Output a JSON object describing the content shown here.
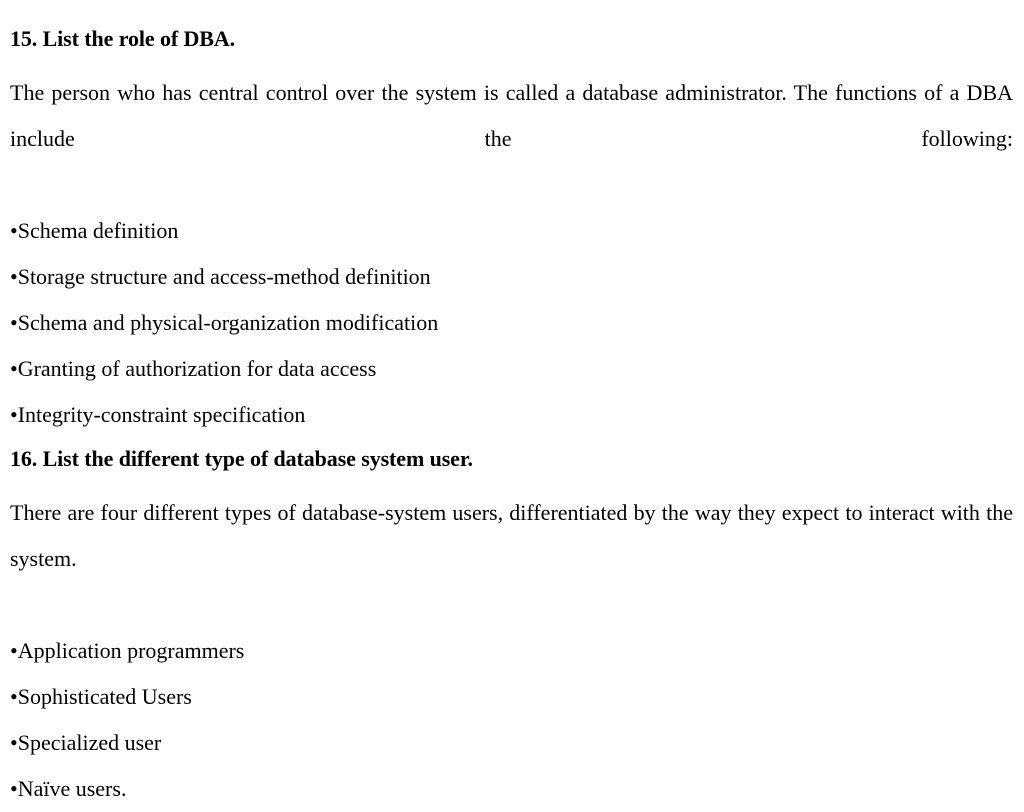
{
  "document": {
    "background_color": "#ffffff",
    "text_color": "#000000",
    "bullet_glyph": "•"
  },
  "blocks": [
    {
      "id": "q15",
      "heading": "15. List the role of DBA.",
      "paragraph": "The person who has central control over the system is called a database administrator. The functions of a DBA include the following:",
      "bullets": [
        "Schema definition",
        "Storage structure and access-method definition",
        "Schema and physical-organization modification",
        "Granting of authorization for data access",
        "Integrity-constraint specification"
      ]
    },
    {
      "id": "q16",
      "heading": "16. List the different type of database system user.",
      "paragraph": "There are four different types of database-system users, differentiated by the way they expect to interact with the system.",
      "bullets": [
        "Application programmers",
        "Sophisticated Users",
        "Specialized user",
        "Naïve users."
      ]
    }
  ]
}
